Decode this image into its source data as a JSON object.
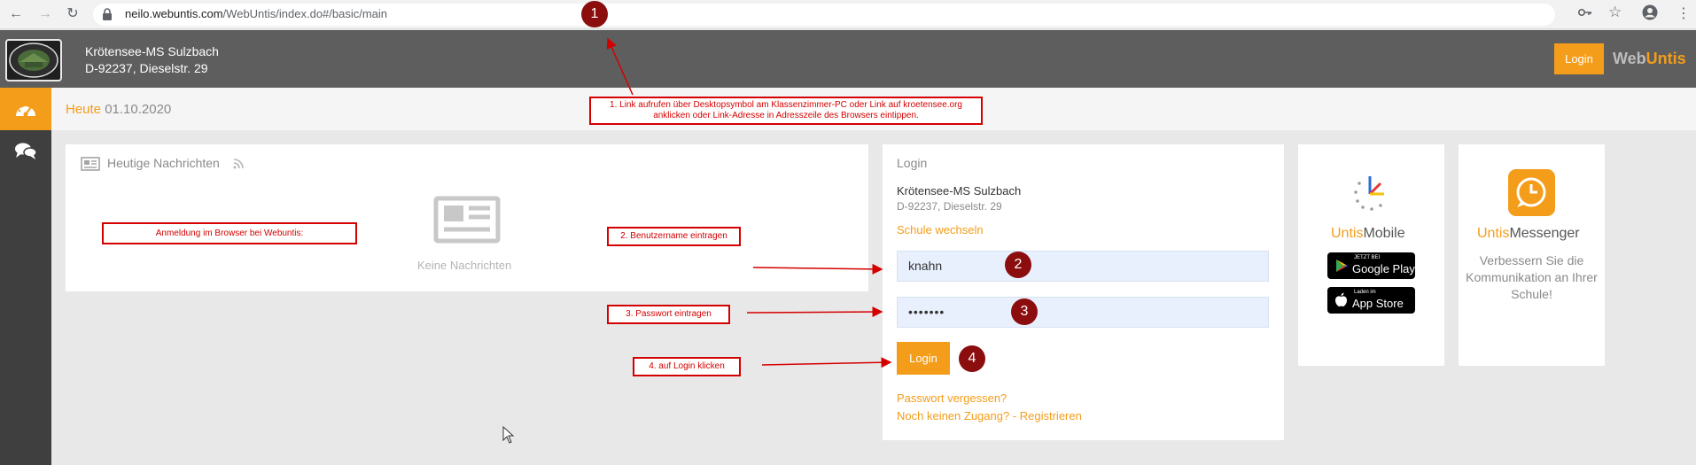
{
  "browser": {
    "url_host": "neilo.webuntis.com",
    "url_path": "/WebUntis/index.do#/basic/main"
  },
  "header": {
    "school_name": "Krötensee-MS Sulzbach",
    "school_address": "D-92237, Dieselstr. 29",
    "login_label": "Login",
    "brand_web": "Web",
    "brand_untis": "Untis"
  },
  "subheader": {
    "today_label": "Heute",
    "date": "01.10.2020"
  },
  "news": {
    "title": "Heutige Nachrichten",
    "empty_text": "Keine Nachrichten"
  },
  "login_panel": {
    "title": "Login",
    "school_name": "Krötensee-MS Sulzbach",
    "school_address": "D-92237, Dieselstr. 29",
    "switch_school": "Schule wechseln",
    "username_value": "knahn",
    "password_value": "•••••••",
    "login_button": "Login",
    "forgot_password": "Passwort vergessen?",
    "register": "Noch keinen Zugang? - Registrieren"
  },
  "untis_mobile": {
    "title_orange": "Untis",
    "title_gray": "Mobile",
    "google_small": "JETZT BEI",
    "google_big": "Google Play",
    "apple_small": "Laden im",
    "apple_big": "App Store"
  },
  "untis_messenger": {
    "title_orange": "Untis",
    "title_gray": "Messenger",
    "description": "Verbessern Sie die Kommunikation an Ihrer Schule!"
  },
  "annotations": {
    "step1": "1. Link aufrufen über Desktopsymbol am Klassenzimmer-PC oder Link auf kroetensee.org anklicken oder Link-Adresse in Adresszeile des Browsers eintippen.",
    "intro": "Anmeldung im Browser bei Webuntis:",
    "step2": "2. Benutzername eintragen",
    "step3": "3. Passwort eintragen",
    "step4": "4. auf Login klicken",
    "marker1": "1",
    "marker2": "2",
    "marker3": "3",
    "marker4": "4"
  },
  "colors": {
    "accent": "#f49d1a",
    "header_bg": "#5e5e5e",
    "nav_bg": "#3f3f3f",
    "annotation_red": "#d40000",
    "marker_red": "#8b0d0d"
  }
}
